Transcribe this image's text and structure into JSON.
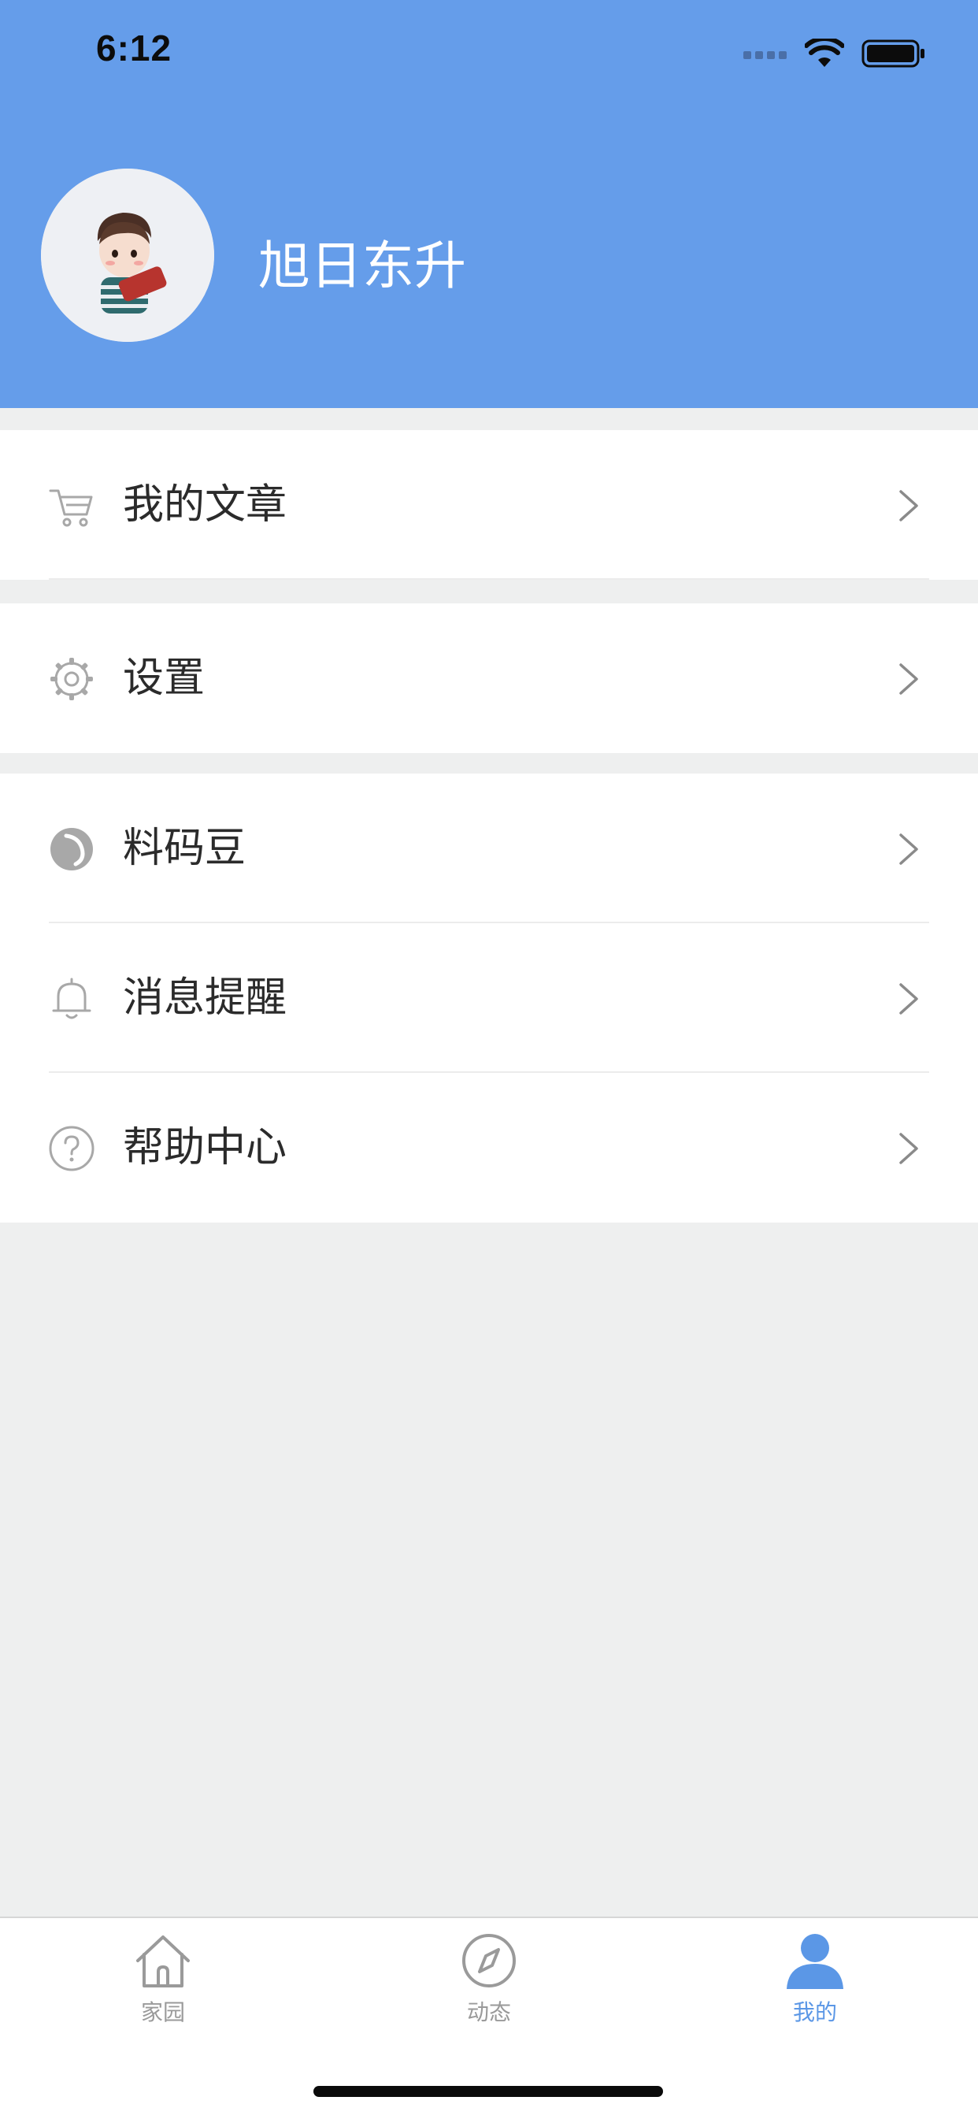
{
  "status_bar": {
    "time": "6:12"
  },
  "profile": {
    "username": "旭日东升"
  },
  "menu": {
    "group1": [
      {
        "label": "我的文章",
        "icon": "cart-icon"
      }
    ],
    "group2": [
      {
        "label": "设置",
        "icon": "gear-icon"
      }
    ],
    "group3": [
      {
        "label": "料码豆",
        "icon": "bean-icon"
      },
      {
        "label": "消息提醒",
        "icon": "bell-icon"
      },
      {
        "label": "帮助中心",
        "icon": "help-icon"
      }
    ]
  },
  "tabbar": {
    "tabs": [
      {
        "label": "家园",
        "icon": "home-icon",
        "active": false
      },
      {
        "label": "动态",
        "icon": "compass-icon",
        "active": false
      },
      {
        "label": "我的",
        "icon": "person-icon",
        "active": true
      }
    ]
  },
  "colors": {
    "header": "#659dea",
    "accent": "#5b97e6",
    "inactive": "#9a9a9a",
    "background": "#eeefef"
  }
}
